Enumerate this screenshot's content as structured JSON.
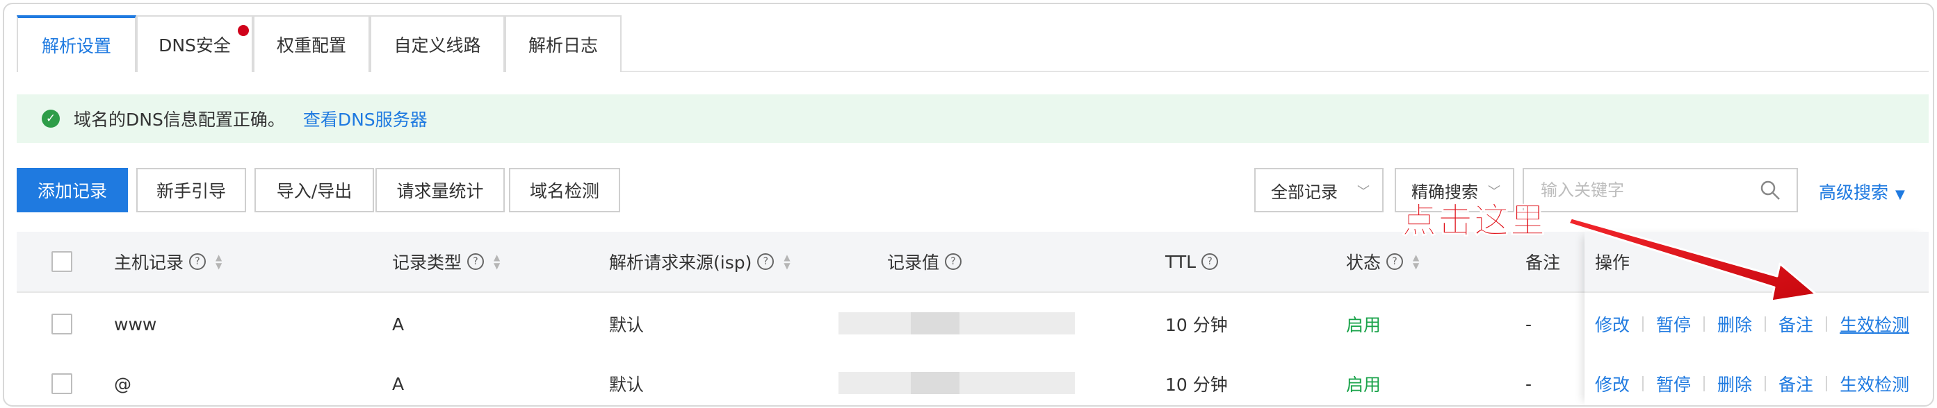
{
  "tabs": [
    {
      "label": "解析设置",
      "active": true
    },
    {
      "label": "DNS安全",
      "badge_dot": true
    },
    {
      "label": "权重配置"
    },
    {
      "label": "自定义线路"
    },
    {
      "label": "解析日志"
    }
  ],
  "notice": {
    "text": "域名的DNS信息配置正确。",
    "link": "查看DNS服务器"
  },
  "toolbar": {
    "add_record": "添加记录",
    "guide": "新手引导",
    "import_export": "导入/导出",
    "request_stats": "请求量统计",
    "domain_check": "域名检测",
    "filter_select": "全部记录",
    "search_mode": "精确搜索",
    "search_placeholder": "输入关键字",
    "advanced_search": "高级搜索"
  },
  "table": {
    "headers": {
      "host": "主机记录",
      "type": "记录类型",
      "isp": "解析请求来源(isp)",
      "value": "记录值",
      "ttl": "TTL",
      "status": "状态",
      "remark": "备注",
      "ops": "操作"
    },
    "rows": [
      {
        "host": "www",
        "type": "A",
        "isp": "默认",
        "ttl": "10 分钟",
        "status": "启用",
        "remark": "-"
      },
      {
        "host": "@",
        "type": "A",
        "isp": "默认",
        "ttl": "10 分钟",
        "status": "启用",
        "remark": "-"
      }
    ],
    "actions": {
      "modify": "修改",
      "pause": "暂停",
      "delete": "删除",
      "remark": "备注",
      "check": "生效检测"
    }
  },
  "annotation": {
    "text": "点击这里",
    "color": "#e0141c"
  },
  "colors": {
    "accent": "#1f7ae0",
    "success": "#1aa34a",
    "notice_bg": "#eaf8ee"
  }
}
